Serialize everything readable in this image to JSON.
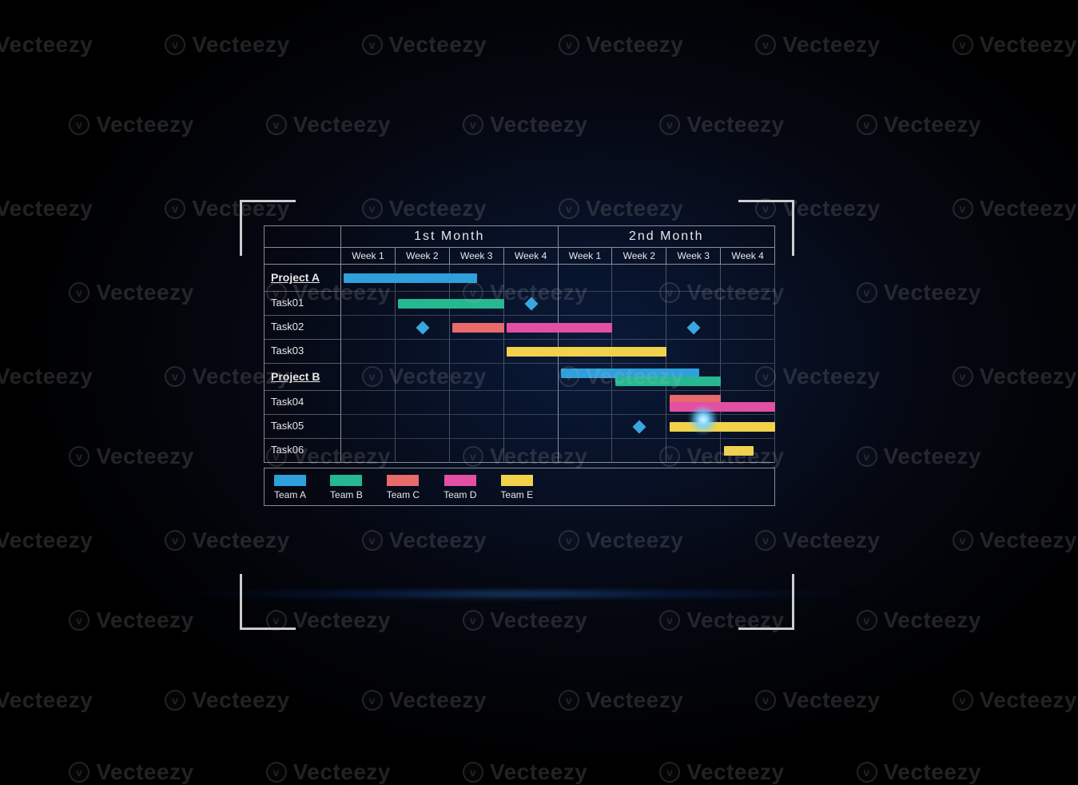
{
  "watermark_text": "Vecteezy",
  "chart_data": {
    "type": "gantt",
    "months": [
      "1st  Month",
      "2nd  Month"
    ],
    "weeks": [
      "Week 1",
      "Week 2",
      "Week 3",
      "Week 4",
      "Week 1",
      "Week 2",
      "Week 3",
      "Week 4"
    ],
    "teams": [
      {
        "id": "teamA",
        "name": "Team A",
        "color": "#2ea0db"
      },
      {
        "id": "teamB",
        "name": "Team B",
        "color": "#26b890"
      },
      {
        "id": "teamC",
        "name": "Team C",
        "color": "#e86a6a"
      },
      {
        "id": "teamD",
        "name": "Team D",
        "color": "#e24fa3"
      },
      {
        "id": "teamE",
        "name": "Team E",
        "color": "#f2d24b"
      }
    ],
    "projects": [
      {
        "name": "Project A",
        "header_bars": [
          {
            "team": "teamA",
            "start": 0.05,
            "end": 2.5
          }
        ],
        "tasks": [
          {
            "name": "Task01",
            "bars": [
              {
                "team": "teamB",
                "start": 1.05,
                "end": 3.0
              }
            ],
            "milestones": [
              3.5
            ]
          },
          {
            "name": "Task02",
            "bars": [
              {
                "team": "teamC",
                "start": 2.05,
                "end": 3.0
              },
              {
                "team": "teamD",
                "start": 3.05,
                "end": 5.0
              }
            ],
            "milestones": [
              1.5,
              6.5
            ]
          },
          {
            "name": "Task03",
            "bars": [
              {
                "team": "teamE",
                "start": 3.05,
                "end": 6.0
              }
            ],
            "milestones": []
          }
        ]
      },
      {
        "name": "Project B",
        "header_bars": [
          {
            "team": "teamA",
            "start": 4.05,
            "end": 6.6
          },
          {
            "team": "teamB",
            "start": 5.05,
            "end": 7.0
          }
        ],
        "tasks": [
          {
            "name": "Task04",
            "bars": [
              {
                "team": "teamC",
                "start": 6.05,
                "end": 7.0
              },
              {
                "team": "teamD",
                "start": 6.05,
                "end": 8.0
              }
            ],
            "milestones": []
          },
          {
            "name": "Task05",
            "bars": [
              {
                "team": "teamE",
                "start": 6.05,
                "end": 8.0
              }
            ],
            "milestones": [
              5.5
            ]
          },
          {
            "name": "Task06",
            "bars": [
              {
                "team": "teamE",
                "start": 7.05,
                "end": 7.6
              }
            ],
            "milestones": []
          }
        ]
      }
    ]
  }
}
